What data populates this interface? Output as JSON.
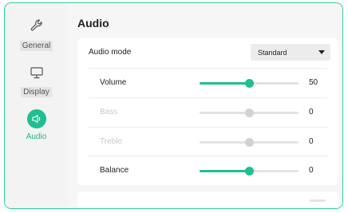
{
  "sidebar": {
    "items": [
      {
        "label": "General",
        "icon": "wrench-icon"
      },
      {
        "label": "Display",
        "icon": "monitor-icon"
      },
      {
        "label": "Audio",
        "icon": "speaker-icon",
        "active": true
      }
    ]
  },
  "main": {
    "title": "Audio",
    "audio_mode": {
      "label": "Audio mode",
      "value": "Standard"
    },
    "volume": {
      "label": "Volume",
      "value": "50",
      "level": 0.5
    },
    "bass": {
      "label": "Bass",
      "value": "0",
      "level": 0.5,
      "disabled": true
    },
    "treble": {
      "label": "Treble",
      "value": "0",
      "level": 0.5,
      "disabled": true
    },
    "balance": {
      "label": "Balance",
      "value": "0",
      "level": 0.5
    }
  },
  "colors": {
    "accent": "#1fbf8f",
    "border": "#2ecfa0"
  }
}
